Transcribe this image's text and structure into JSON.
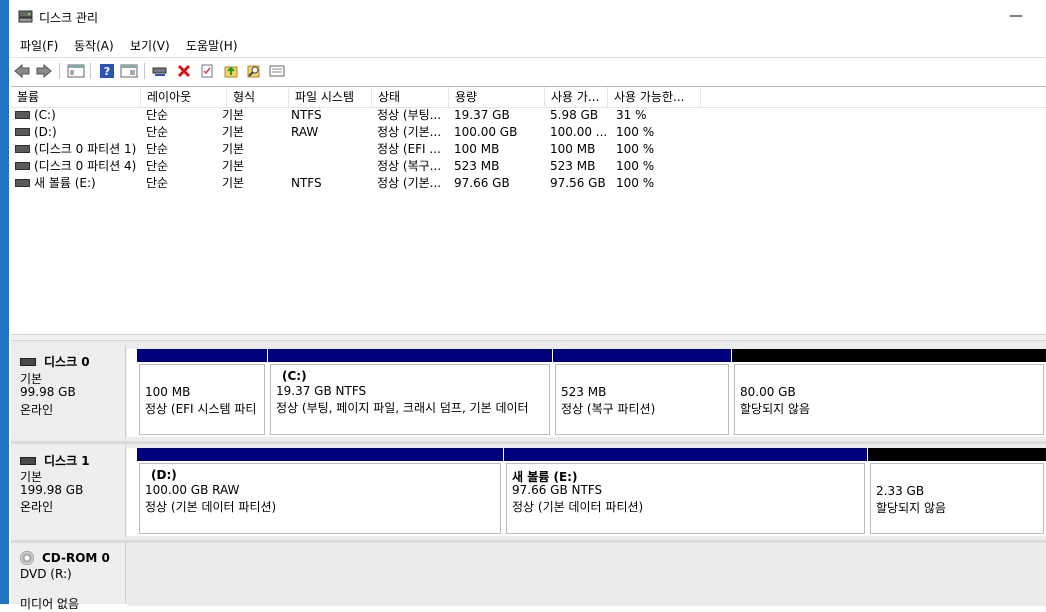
{
  "window": {
    "title": "디스크 관리",
    "minimize_glyph": "—"
  },
  "menu": [
    "파일(F)",
    "동작(A)",
    "보기(V)",
    "도움말(H)"
  ],
  "toolbar": {
    "buttons": [
      "back-arrow-icon",
      "forward-arrow-icon",
      "console-tree-icon",
      "help-icon",
      "show-pane-icon",
      "connect-disk-icon",
      "delete-icon",
      "properties-icon",
      "export-icon",
      "search-icon",
      "list-view-icon"
    ]
  },
  "columns": [
    "볼륨",
    "레이아웃",
    "형식",
    "파일 시스템",
    "상태",
    "용량",
    "사용 가...",
    "사용 가능한..."
  ],
  "volumes": [
    {
      "volume": "(C:)",
      "layout": "단순",
      "type": "기본",
      "fs": "NTFS",
      "status": "정상 (부팅...",
      "capacity": "19.37 GB",
      "free": "5.98 GB",
      "pct": "31 %"
    },
    {
      "volume": "(D:)",
      "layout": "단순",
      "type": "기본",
      "fs": "RAW",
      "status": "정상 (기본...",
      "capacity": "100.00 GB",
      "free": "100.00 ...",
      "pct": "100 %"
    },
    {
      "volume": "(디스크 0 파티션 1)",
      "layout": "단순",
      "type": "기본",
      "fs": "",
      "status": "정상 (EFI ...",
      "capacity": "100 MB",
      "free": "100 MB",
      "pct": "100 %"
    },
    {
      "volume": "(디스크 0 파티션 4)",
      "layout": "단순",
      "type": "기본",
      "fs": "",
      "status": "정상 (복구...",
      "capacity": "523 MB",
      "free": "523 MB",
      "pct": "100 %"
    },
    {
      "volume": "새 볼륨 (E:)",
      "layout": "단순",
      "type": "기본",
      "fs": "NTFS",
      "status": "정상 (기본...",
      "capacity": "97.66 GB",
      "free": "97.56 GB",
      "pct": "100 %"
    }
  ],
  "disks": [
    {
      "name": "디스크 0",
      "kind": "기본",
      "size": "99.98 GB",
      "state": "온라인",
      "partitions": [
        {
          "title": "",
          "line1": "100 MB",
          "line2": "정상 (EFI 시스템 파티",
          "bar": "navy"
        },
        {
          "title": "(C:)",
          "line1": "19.37 GB NTFS",
          "line2": "정상 (부팅, 페이지 파일, 크래시 덤프, 기본 데이터",
          "bar": "navy"
        },
        {
          "title": "",
          "line1": "523 MB",
          "line2": "정상 (복구 파티션)",
          "bar": "navy"
        },
        {
          "title": "",
          "line1": "80.00 GB",
          "line2": "할당되지 않음",
          "bar": "black"
        }
      ]
    },
    {
      "name": "디스크 1",
      "kind": "기본",
      "size": "199.98 GB",
      "state": "온라인",
      "partitions": [
        {
          "title": "(D:)",
          "line1": "100.00 GB RAW",
          "line2": "정상 (기본 데이터 파티션)",
          "bar": "navy"
        },
        {
          "title": "새 볼륨  (E:)",
          "line1": "97.66 GB NTFS",
          "line2": "정상 (기본 데이터 파티션)",
          "bar": "navy"
        },
        {
          "title": "",
          "line1": "2.33 GB",
          "line2": "할당되지 않음",
          "bar": "black"
        }
      ]
    }
  ],
  "cdrom": {
    "name": "CD-ROM 0",
    "kind": "DVD (R:)",
    "state": "미디어 없음"
  },
  "colors": {
    "accent": "#1f74c8",
    "primary_partition": "#00007c",
    "unallocated": "#000000"
  }
}
